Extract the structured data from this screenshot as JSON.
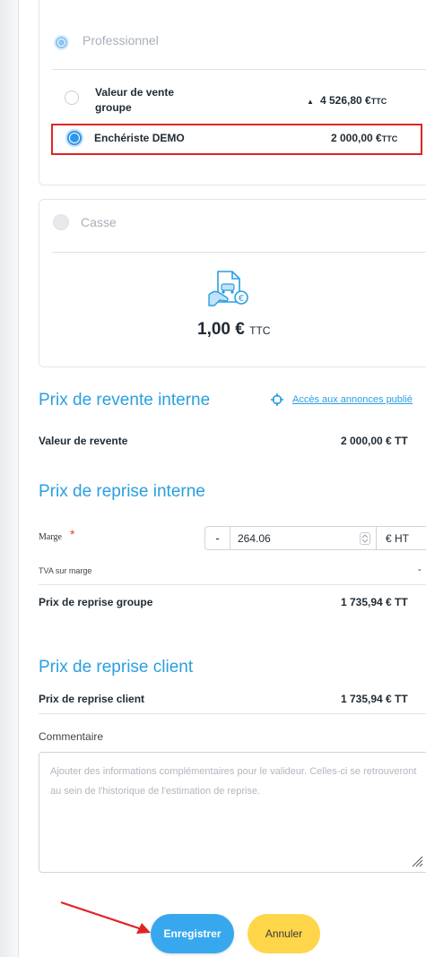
{
  "professional": {
    "label": "Professionnel",
    "rows": [
      {
        "label_line1": "Valeur de vente",
        "label_line2": "groupe",
        "value": "4 526,80 €",
        "unit": "TTC",
        "arrow": "▲"
      },
      {
        "label": "Enchériste DEMO",
        "value": "2 000,00 €",
        "unit": "TTC"
      }
    ]
  },
  "casse": {
    "label": "Casse",
    "icon": "document-car-euro-icon",
    "amount": "1,00 €",
    "unit": "TTC"
  },
  "revente": {
    "title": "Prix de revente interne",
    "link": "Accès aux annonces publié",
    "row_label": "Valeur de revente",
    "row_value": "2 000,00 € TT"
  },
  "reprise_interne": {
    "title": "Prix de reprise interne",
    "marge_label": "Marge",
    "required_mark": "*",
    "sign": "-",
    "marge_value": "264.06",
    "marge_unit": "€ HT",
    "tva_label": "TVA sur marge",
    "tva_value": "-",
    "groupe_label": "Prix de reprise groupe",
    "groupe_value": "1 735,94 € TT"
  },
  "reprise_client": {
    "title": "Prix de reprise client",
    "row_label": "Prix de reprise client",
    "row_value": "1 735,94 € TT"
  },
  "comment": {
    "label": "Commentaire",
    "placeholder": "Ajouter des informations complémentaires pour le valideur. Celles-ci se retrouveront au sein de l'historique de l'estimation de reprise."
  },
  "actions": {
    "save": "Enregistrer",
    "cancel": "Annuler"
  },
  "colors": {
    "accent": "#2a9fe0",
    "save_bg": "#38a8ee",
    "cancel_bg": "#ffd54a",
    "highlight": "#e02424"
  }
}
